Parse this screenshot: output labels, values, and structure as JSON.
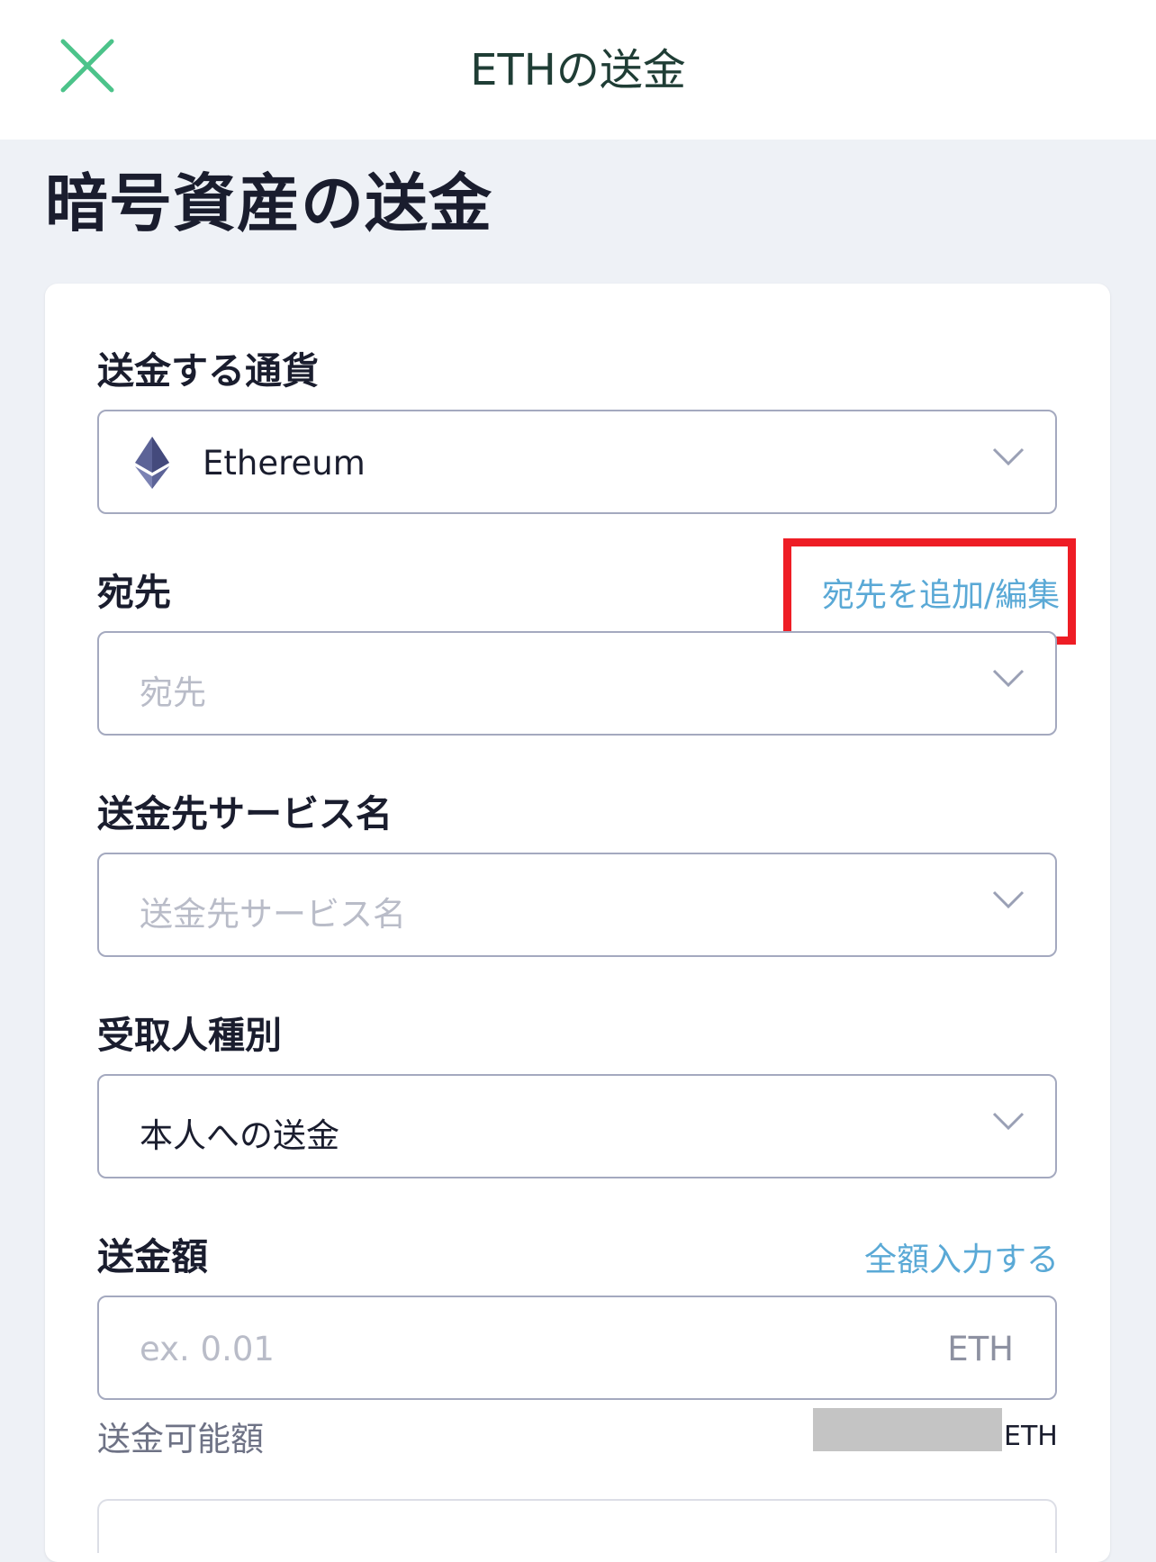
{
  "header": {
    "title": "ETHの送金",
    "close_icon": "close-icon",
    "accent_color": "#4cc38a"
  },
  "page": {
    "title": "暗号資産の送金"
  },
  "form": {
    "currency": {
      "label": "送金する通貨",
      "value": "Ethereum",
      "icon": "ethereum-icon"
    },
    "destination": {
      "label": "宛先",
      "action_link": "宛先を追加/編集",
      "placeholder": "宛先",
      "highlight_color": "#ee1d25"
    },
    "service_name": {
      "label": "送金先サービス名",
      "placeholder": "送金先サービス名"
    },
    "recipient_type": {
      "label": "受取人種別",
      "value": "本人への送金"
    },
    "amount": {
      "label": "送金額",
      "action_link": "全額入力する",
      "placeholder": "ex. 0.01",
      "unit": "ETH"
    },
    "available": {
      "label": "送金可能額",
      "unit": "ETH"
    }
  }
}
